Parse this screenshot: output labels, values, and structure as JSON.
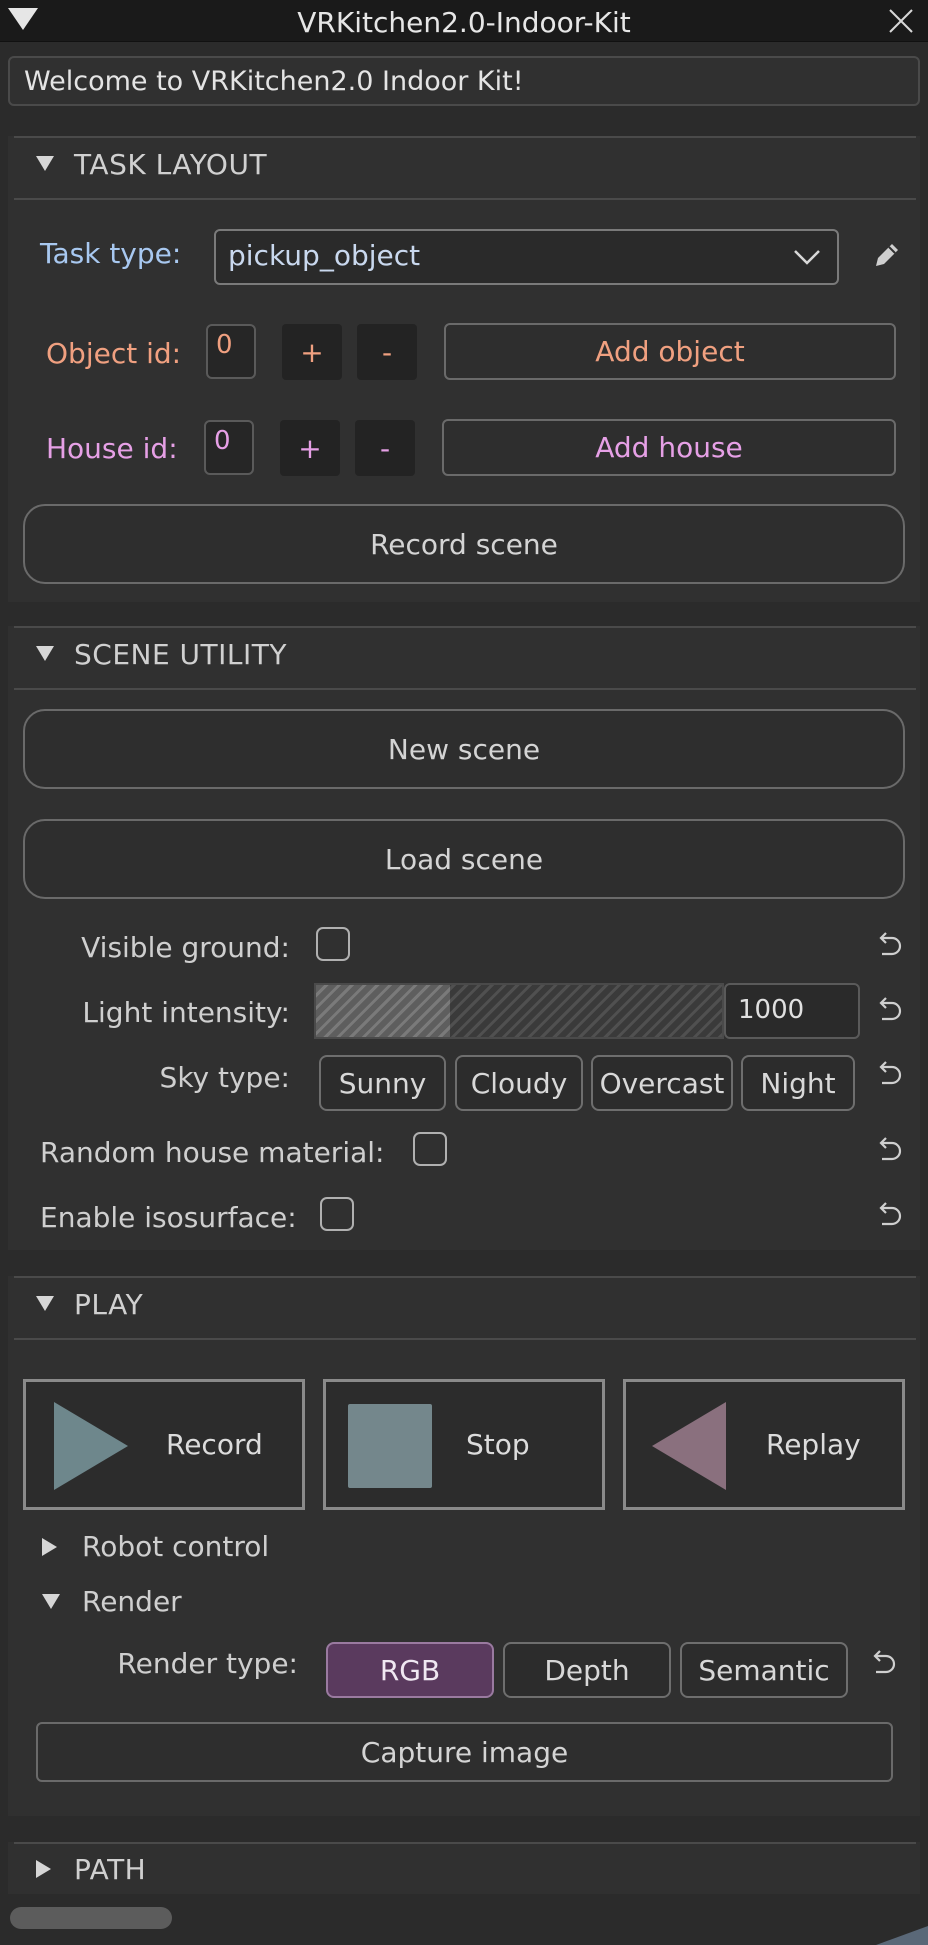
{
  "window": {
    "title": "VRKitchen2.0-Indoor-Kit"
  },
  "welcome": "Welcome to VRKitchen2.0 Indoor Kit!",
  "task_layout": {
    "header": "TASK LAYOUT",
    "task_type_label": "Task type:",
    "task_type_value": "pickup_object",
    "object_id_label": "Object id:",
    "object_id_value": "0",
    "plus": "+",
    "minus": "-",
    "add_object": "Add object",
    "house_id_label": "House id:",
    "house_id_value": "0",
    "add_house": "Add house",
    "record_scene": "Record scene"
  },
  "scene_utility": {
    "header": "SCENE UTILITY",
    "new_scene": "New scene",
    "load_scene": "Load scene",
    "visible_ground_label": "Visible ground:",
    "light_intensity_label": "Light intensity:",
    "light_intensity_value": "1000",
    "light_intensity_fraction": 0.33,
    "sky_type_label": "Sky type:",
    "sky_options": [
      "Sunny",
      "Cloudy",
      "Overcast",
      "Night"
    ],
    "random_house_material_label": "Random house material:",
    "enable_isosurface_label": "Enable isosurface:"
  },
  "play": {
    "header": "PLAY",
    "record": "Record",
    "stop": "Stop",
    "replay": "Replay",
    "robot_control": "Robot control",
    "render": "Render",
    "render_type_label": "Render type:",
    "render_options": [
      "RGB",
      "Depth",
      "Semantic"
    ],
    "render_selected": "RGB",
    "capture_image": "Capture image"
  },
  "path": {
    "header": "PATH"
  },
  "colors": {
    "object_label": "#f0a080",
    "house_label": "#e6a0e6",
    "task_label": "#a8c8f0",
    "record_icon": "#6e878c",
    "stop_icon": "#74878c",
    "replay_icon": "#8a707e",
    "rgb_active": "#5a3a5e"
  }
}
